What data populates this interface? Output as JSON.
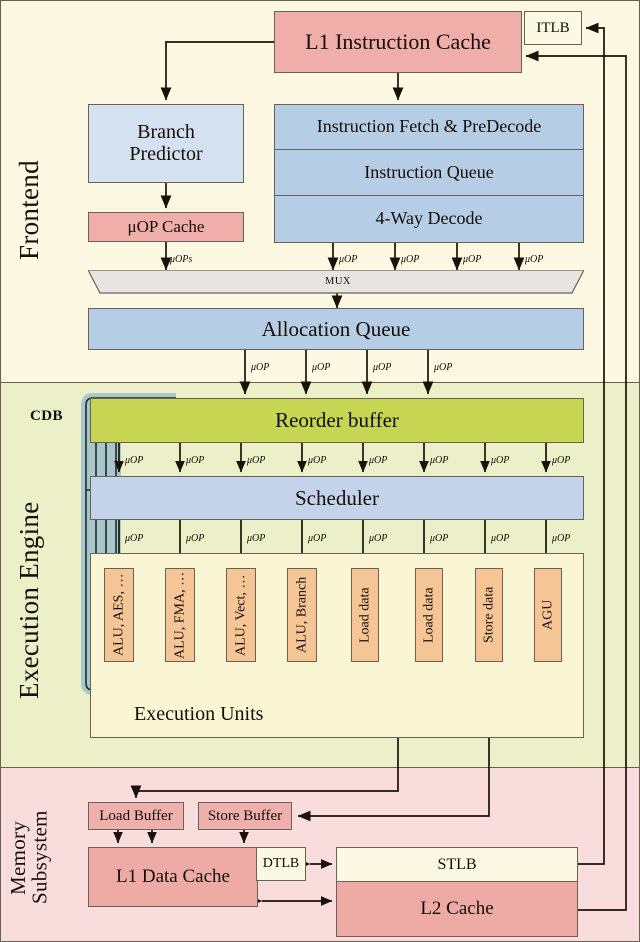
{
  "diagram": {
    "title": "CPU Microarchitecture Block Diagram",
    "sections": [
      {
        "id": "frontend",
        "label": "Frontend",
        "bg": "#fdf8e1"
      },
      {
        "id": "execution_engine",
        "label": "Execution Engine",
        "bg": "#ecf0c8"
      },
      {
        "id": "memory_subsystem",
        "label": "Memory\nSubsystem",
        "bg": "#f9dcdc"
      }
    ]
  },
  "frontend": {
    "l1_instruction_cache": "L1 Instruction Cache",
    "itlb": "ITLB",
    "branch_predictor_line1": "Branch",
    "branch_predictor_line2": "Predictor",
    "uop_cache": "μOP Cache",
    "instruction_fetch_predecode": "Instruction Fetch & PreDecode",
    "instruction_queue": "Instruction Queue",
    "decode": "4-Way Decode",
    "mux": "MUX",
    "allocation_queue": "Allocation Queue",
    "bus_labels": {
      "uops_plural": "μOPs",
      "uop": "μOP"
    },
    "decode_bus_count": 4,
    "alloc_bus_count": 4
  },
  "execution_engine": {
    "cdb_label": "CDB",
    "reorder_buffer": "Reorder buffer",
    "scheduler": "Scheduler",
    "execution_units_label": "Execution Units",
    "rob_bus_count": 8,
    "sched_bus_count": 8,
    "bus_label": "μOP",
    "units": [
      {
        "name": "alu-aes",
        "label": "ALU, AES, …"
      },
      {
        "name": "alu-fma",
        "label": "ALU, FMA, …"
      },
      {
        "name": "alu-vect",
        "label": "ALU, Vect, …"
      },
      {
        "name": "alu-branch",
        "label": "ALU, Branch"
      },
      {
        "name": "load-data-0",
        "label": "Load data"
      },
      {
        "name": "load-data-1",
        "label": "Load data"
      },
      {
        "name": "store-data",
        "label": "Store data"
      },
      {
        "name": "agu",
        "label": "AGU"
      }
    ],
    "cdb_lanes": 4
  },
  "memory_subsystem": {
    "load_buffer": "Load Buffer",
    "store_buffer": "Store Buffer",
    "l1_data_cache": "L1 Data Cache",
    "dtlb": "DTLB",
    "stlb": "STLB",
    "l2_cache": "L2 Cache"
  },
  "colors": {
    "cache_red": "#f0aeab",
    "frontend_blue": "#b6cde6",
    "branch_predictor_blue": "#d4e1f0",
    "reorder_green": "#c6d653",
    "scheduler_blue": "#c3d4ea",
    "exec_unit_orange": "#f6c595",
    "mux_grey": "#e7e5e2",
    "tlb_cream": "#fbf8e3",
    "band_frontend": "#fdf8e1",
    "band_execution": "#ecf0c8",
    "band_memory": "#f9dcdc",
    "cdb_teal": "#b9d2d6",
    "wire": "#1a1208"
  }
}
